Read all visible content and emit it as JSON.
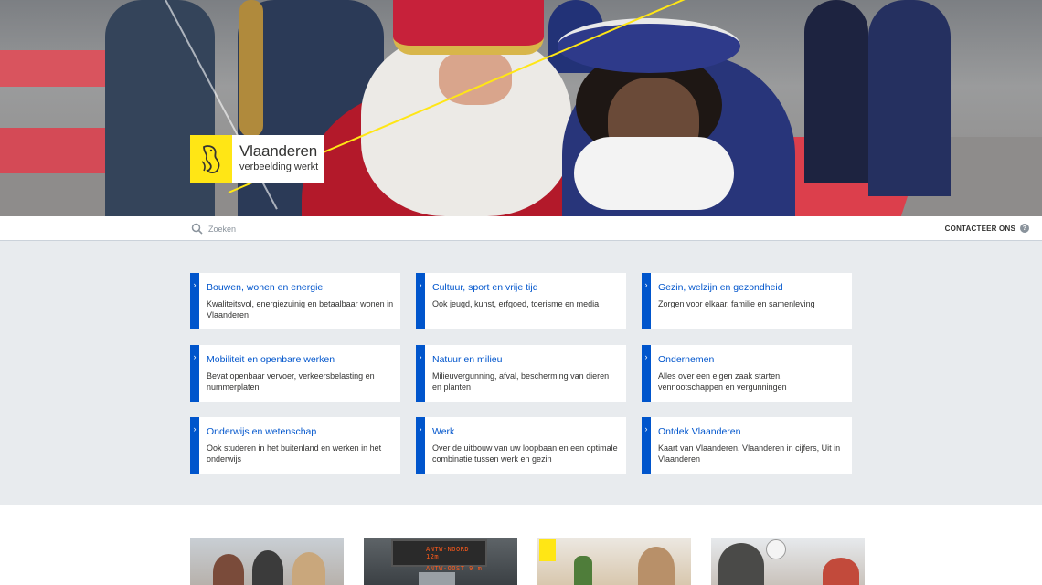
{
  "brand": {
    "name": "Vlaanderen",
    "tagline": "verbeelding werkt",
    "accent": "#ffe615",
    "link_color": "#0055cc"
  },
  "search": {
    "placeholder": "Zoeken"
  },
  "header": {
    "contact_label": "CONTACTEER ONS",
    "help_glyph": "?"
  },
  "themes": [
    {
      "title": "Bouwen, wonen en energie",
      "desc": "Kwaliteitsvol, energiezuinig en betaalbaar wonen in Vlaanderen"
    },
    {
      "title": "Cultuur, sport en vrije tijd",
      "desc": "Ook jeugd, kunst, erfgoed, toerisme en media"
    },
    {
      "title": "Gezin, welzijn en gezondheid",
      "desc": "Zorgen voor elkaar, familie en samenleving"
    },
    {
      "title": "Mobiliteit en openbare werken",
      "desc": "Bevat openbaar vervoer, verkeersbelasting en nummerplaten"
    },
    {
      "title": "Natuur en milieu",
      "desc": "Milieuvergunning, afval, bescherming van dieren en planten"
    },
    {
      "title": "Ondernemen",
      "desc": "Alles over een eigen zaak starten, vennootschappen en vergunningen"
    },
    {
      "title": "Onderwijs en wetenschap",
      "desc": "Ook studeren in het buitenland en werken in het onderwijs"
    },
    {
      "title": "Werk",
      "desc": "Over de uitbouw van uw loopbaan en een optimale combinatie tussen werk en gezin"
    },
    {
      "title": "Ontdek Vlaanderen",
      "desc": "Kaart van Vlaanderen, Vlaanderen in cijfers, Uit in Vlaanderen"
    }
  ],
  "tiles": {
    "sign_line1": "ANTW-NOORD  12m",
    "sign_line2": "ANTW-OOST    9 m"
  },
  "icons": {
    "search": "search-icon",
    "help": "help-icon",
    "chevron": "chevron-right-icon",
    "logo": "flemish-lion-icon"
  }
}
